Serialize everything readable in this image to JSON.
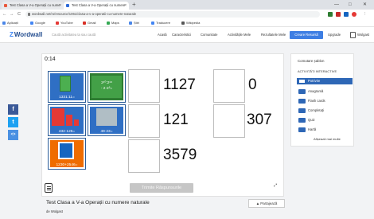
{
  "browser": {
    "tabs": [
      {
        "title": "Test Clasa a V-a Operații cu nume"
      },
      {
        "title": "Test Clasa a V-a Operații cu numere"
      }
    ],
    "new_tab": "+",
    "window_controls": [
      "—",
      "□",
      "✕"
    ],
    "url": "wordwall.net/ro/resource/1061/clasa-a-v-a-operatii-cu-numere-naturale",
    "nav": {
      "back": "←",
      "forward": "→",
      "reload": "C"
    },
    "bookmarks": [
      "Aplicații",
      "Google",
      "YouTube",
      "Gmail",
      "Maps",
      "Știri",
      "Traducere",
      "Wikipedia"
    ],
    "bookmark_colors": [
      "#4a86e8",
      "#4285f4",
      "#e53935",
      "#d93025",
      "#34a853",
      "#4a86e8",
      "#4285f4",
      "#555555"
    ]
  },
  "header": {
    "logo": "Wordwall",
    "search_placeholder": "Caută activitatea ta sau caută",
    "nav": [
      "Acasă",
      "Caracteristici",
      "Comunitate",
      "Activitățile Mele",
      "Rezultatele Mele"
    ],
    "create_button": "Creare Resursă",
    "upgrade": "Upgrade",
    "account": "Wolgast"
  },
  "social": [
    {
      "icon": "facebook-icon",
      "glyph": "f",
      "color": "#3b5998"
    },
    {
      "icon": "twitter-icon",
      "glyph": "t",
      "color": "#1da1f2"
    },
    {
      "icon": "share-icon",
      "glyph": "<>",
      "color": "#4a90e2"
    }
  ],
  "game": {
    "timer": "0:14",
    "cards": [
      {
        "label": "1331:11=",
        "color": "#2e7d32"
      },
      {
        "label": "2¹⁰:2¹⁸",
        "label2": "- 2·2³=",
        "color": "#f9a825"
      },
      {
        "label": "432·125=",
        "color": "#c62828"
      },
      {
        "label": "49·23=",
        "color": "#1565c0"
      },
      {
        "label": "1230+2546=",
        "color": "#ef6c00"
      }
    ],
    "answers": [
      "1127",
      "0",
      "121",
      "307",
      "3579"
    ],
    "submit": "Trimite Răspunsurile",
    "fullscreen": "⤢"
  },
  "panel": {
    "title": "Comutare șablon",
    "subtitle": "ACTIVITĂȚI INTERACTIVE",
    "templates": [
      "Potrivire",
      "Anagramă",
      "Flash cards",
      "Completați",
      "Quiz",
      "Hartă",
      "Roata aleatorie"
    ],
    "active_index": 0,
    "more": "Afișează mai multe"
  },
  "page": {
    "title": "Test Clasa a V-a Operații cu numere naturale",
    "author": "de Wolgast",
    "share": "Partajează"
  }
}
